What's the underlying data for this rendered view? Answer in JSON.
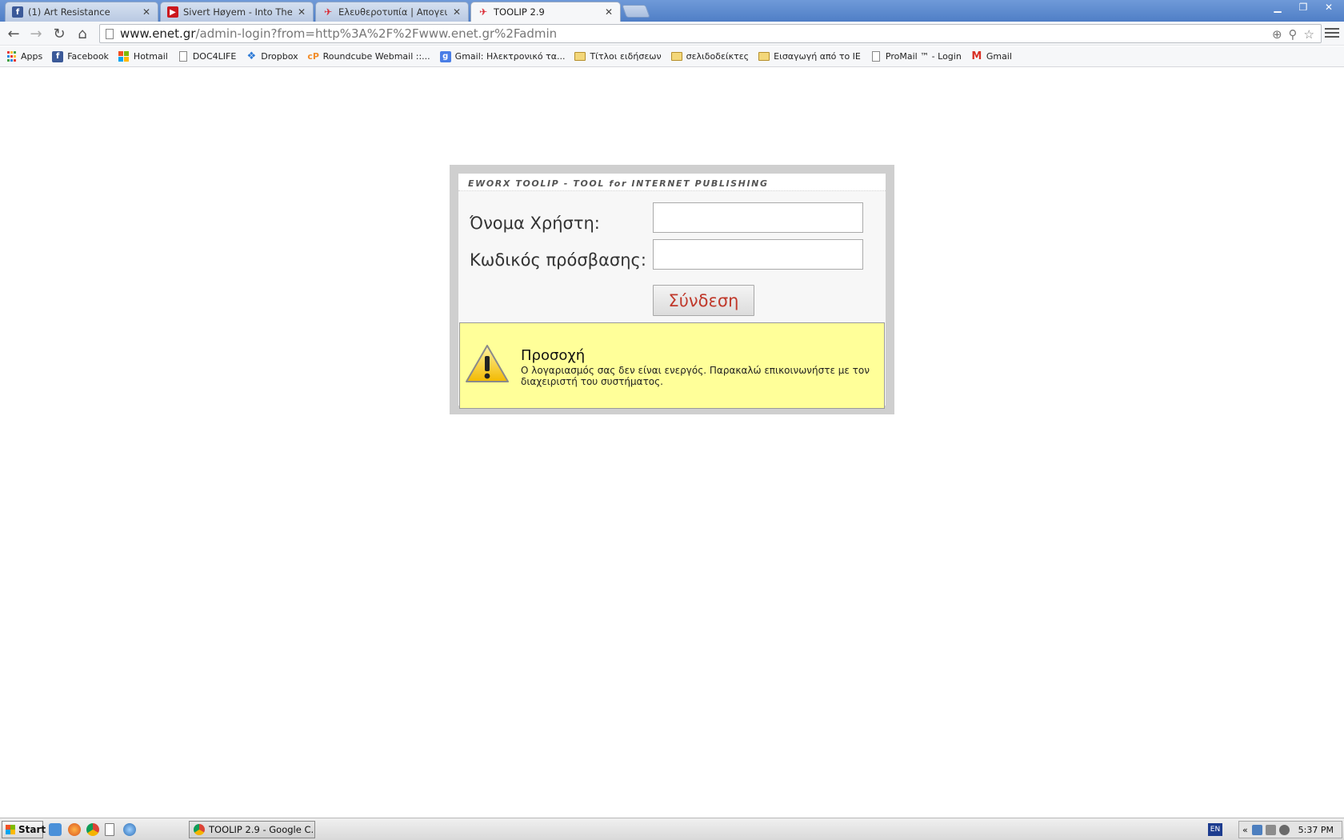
{
  "browser": {
    "tabs": [
      {
        "title": "(1) Art Resistance",
        "favicon": "facebook-icon",
        "color": "#3b5998",
        "state": "inactive"
      },
      {
        "title": "Sivert Høyem - Into The Sea",
        "favicon": "youtube-icon",
        "color": "#cc181e",
        "state": "inactive"
      },
      {
        "title": "Ελευθεροτυπία | Απογευματινή",
        "favicon": "toolip-icon",
        "color": "#d9232d",
        "state": "inactive"
      },
      {
        "title": "TOOLIP 2.9",
        "favicon": "toolip-icon",
        "color": "#d9232d",
        "state": "active"
      }
    ],
    "url_host": "www.enet.gr",
    "url_path": "/admin-login?from=http%3A%2F%2Fwww.enet.gr%2Fadmin",
    "bookmarks": [
      {
        "label": "Apps",
        "icon": "apps-icon"
      },
      {
        "label": "Facebook",
        "icon": "facebook-icon",
        "color": "#3b5998"
      },
      {
        "label": "Hotmail",
        "icon": "windows-icon"
      },
      {
        "label": "DOC4LIFE",
        "icon": "page-icon"
      },
      {
        "label": "Dropbox",
        "icon": "dropbox-icon",
        "color": "#2d7ad6"
      },
      {
        "label": "Roundcube Webmail ::...",
        "icon": "cpanel-icon",
        "color": "#f28c28"
      },
      {
        "label": "Gmail: Ηλεκτρονικό τα...",
        "icon": "google-icon",
        "color": "#4a7ee6"
      },
      {
        "label": "Τίτλοι ειδήσεων",
        "icon": "folder-icon"
      },
      {
        "label": "σελιδοδείκτες",
        "icon": "folder-icon"
      },
      {
        "label": "Εισαγωγή από το IE",
        "icon": "folder-icon"
      },
      {
        "label": "ProMail ™ - Login",
        "icon": "page-icon"
      },
      {
        "label": "Gmail",
        "icon": "gmail-icon",
        "color": "#d93025"
      }
    ]
  },
  "login": {
    "header": "EWORX TOOLIP - TOOL for INTERNET PUBLISHING",
    "username_label": "Όνομα Χρήστη:",
    "username_value": "",
    "password_label": "Κωδικός πρόσβασης:",
    "password_value": "",
    "submit_label": "Σύνδεση",
    "alert_title": "Προσοχή",
    "alert_message": "Ο λογαριασμός σας δεν είναι ενεργός. Παρακαλώ επικοινωνήστε με τον διαχειριστή του συστήματος.",
    "alert_icon": "warning-icon"
  },
  "taskbar": {
    "start_label": "Start",
    "task_label": "TOOLIP 2.9 - Google C...",
    "language": "EN",
    "clock": "5:37 PM"
  }
}
